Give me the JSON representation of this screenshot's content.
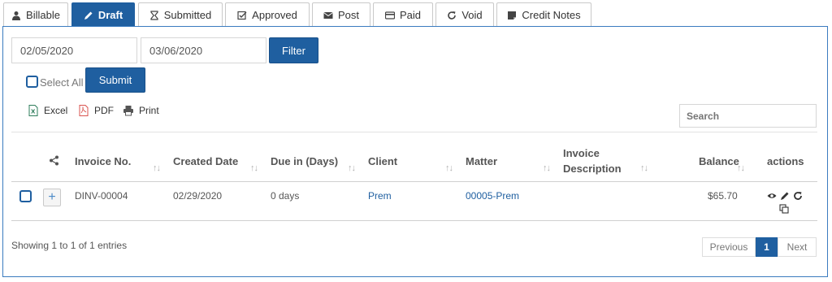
{
  "tabs": [
    {
      "label": "Billable",
      "icon": "user-icon"
    },
    {
      "label": "Draft",
      "icon": "pencil-icon"
    },
    {
      "label": "Submitted",
      "icon": "hourglass-icon"
    },
    {
      "label": "Approved",
      "icon": "check-square-icon"
    },
    {
      "label": "Post",
      "icon": "envelope-icon"
    },
    {
      "label": "Paid",
      "icon": "credit-card-icon"
    },
    {
      "label": "Void",
      "icon": "refresh-icon"
    },
    {
      "label": "Credit Notes",
      "icon": "note-icon"
    }
  ],
  "filter": {
    "date_from": "02/05/2020",
    "date_to": "03/06/2020",
    "filter_label": "Filter",
    "select_all_label": "Select All",
    "submit_label": "Submit"
  },
  "toolbar": {
    "excel_label": "Excel",
    "pdf_label": "PDF",
    "print_label": "Print",
    "search_placeholder": "Search"
  },
  "table": {
    "headers": {
      "invoice_no": "Invoice No.",
      "created_date": "Created Date",
      "due_in": "Due in (Days)",
      "client": "Client",
      "matter": "Matter",
      "invoice_desc_line1": "Invoice",
      "invoice_desc_line2": "Description",
      "balance": "Balance",
      "actions": "actions"
    },
    "rows": [
      {
        "invoice_no": "DINV-00004",
        "created_date": "02/29/2020",
        "due_in": "0 days",
        "client": "Prem",
        "matter": "00005-Prem",
        "description": "",
        "balance": "$65.70"
      }
    ]
  },
  "footer": {
    "info": "Showing 1 to 1 of 1 entries",
    "previous_label": "Previous",
    "current_page": "1",
    "next_label": "Next"
  },
  "colors": {
    "accent": "#1f5fa0",
    "link": "#1f5fa0",
    "pdf_red": "#d9534f",
    "excel_green": "#2e7d5b"
  }
}
